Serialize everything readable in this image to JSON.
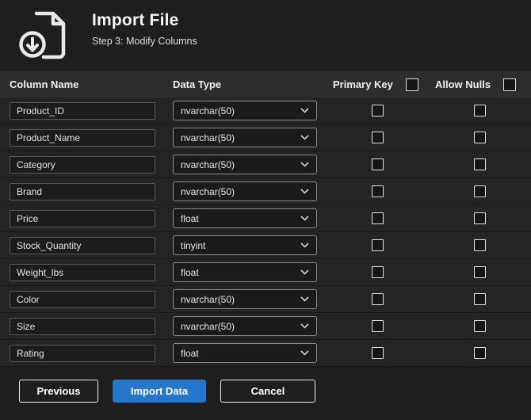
{
  "header": {
    "title": "Import File",
    "subtitle": "Step 3: Modify Columns"
  },
  "table": {
    "headers": {
      "column_name": "Column Name",
      "data_type": "Data Type",
      "primary_key": "Primary Key",
      "allow_nulls": "Allow Nulls"
    },
    "header_checkboxes": {
      "primary_key_checked": false,
      "allow_nulls_checked": false
    },
    "rows": [
      {
        "name": "Product_ID",
        "type": "nvarchar(50)",
        "primary_key": false,
        "allow_nulls": false
      },
      {
        "name": "Product_Name",
        "type": "nvarchar(50)",
        "primary_key": false,
        "allow_nulls": false
      },
      {
        "name": "Category",
        "type": "nvarchar(50)",
        "primary_key": false,
        "allow_nulls": false
      },
      {
        "name": "Brand",
        "type": "nvarchar(50)",
        "primary_key": false,
        "allow_nulls": false
      },
      {
        "name": "Price",
        "type": "float",
        "primary_key": false,
        "allow_nulls": false
      },
      {
        "name": "Stock_Quantity",
        "type": "tinyint",
        "primary_key": false,
        "allow_nulls": false
      },
      {
        "name": "Weight_lbs",
        "type": "float",
        "primary_key": false,
        "allow_nulls": false
      },
      {
        "name": "Color",
        "type": "nvarchar(50)",
        "primary_key": false,
        "allow_nulls": false
      },
      {
        "name": "Size",
        "type": "nvarchar(50)",
        "primary_key": false,
        "allow_nulls": false
      },
      {
        "name": "Rating",
        "type": "float",
        "primary_key": false,
        "allow_nulls": false
      }
    ]
  },
  "footer": {
    "previous_label": "Previous",
    "import_label": "Import Data",
    "cancel_label": "Cancel"
  },
  "colors": {
    "accent": "#2577ce",
    "background": "#1e1e1e",
    "table_header": "#2d2d2d"
  }
}
